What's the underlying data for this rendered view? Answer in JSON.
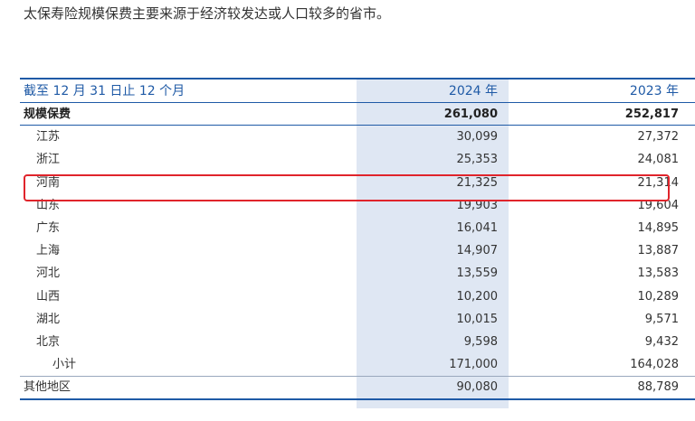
{
  "intro_text": "太保寿险规模保费主要来源于经济较发达或人口较多的省市。",
  "table": {
    "header": {
      "label": "截至 12 月 31 日止 12 个月",
      "col_2024": "2024 年",
      "col_2023": "2023 年"
    },
    "total_row": {
      "label": "规模保费",
      "v2024": "261,080",
      "v2023": "252,817"
    },
    "province_rows": [
      {
        "label": "江苏",
        "v2024": "30,099",
        "v2023": "27,372"
      },
      {
        "label": "浙江",
        "v2024": "25,353",
        "v2023": "24,081"
      },
      {
        "label": "河南",
        "v2024": "21,325",
        "v2023": "21,314"
      },
      {
        "label": "山东",
        "v2024": "19,903",
        "v2023": "19,604"
      },
      {
        "label": "广东",
        "v2024": "16,041",
        "v2023": "14,895"
      },
      {
        "label": "上海",
        "v2024": "14,907",
        "v2023": "13,887"
      },
      {
        "label": "河北",
        "v2024": "13,559",
        "v2023": "13,583"
      },
      {
        "label": "山西",
        "v2024": "10,200",
        "v2023": "10,289"
      },
      {
        "label": "湖北",
        "v2024": "10,015",
        "v2023": "9,571"
      },
      {
        "label": "北京",
        "v2024": "9,598",
        "v2023": "9,432"
      }
    ],
    "subtotal_row": {
      "label": "小计",
      "v2024": "171,000",
      "v2023": "164,028"
    },
    "other_row": {
      "label": "其他地区",
      "v2024": "90,080",
      "v2023": "88,789"
    }
  },
  "colors": {
    "accent_blue": "#1f5aa6",
    "column_highlight": "#dfe7f3",
    "highlight_box": "#e0242b"
  }
}
